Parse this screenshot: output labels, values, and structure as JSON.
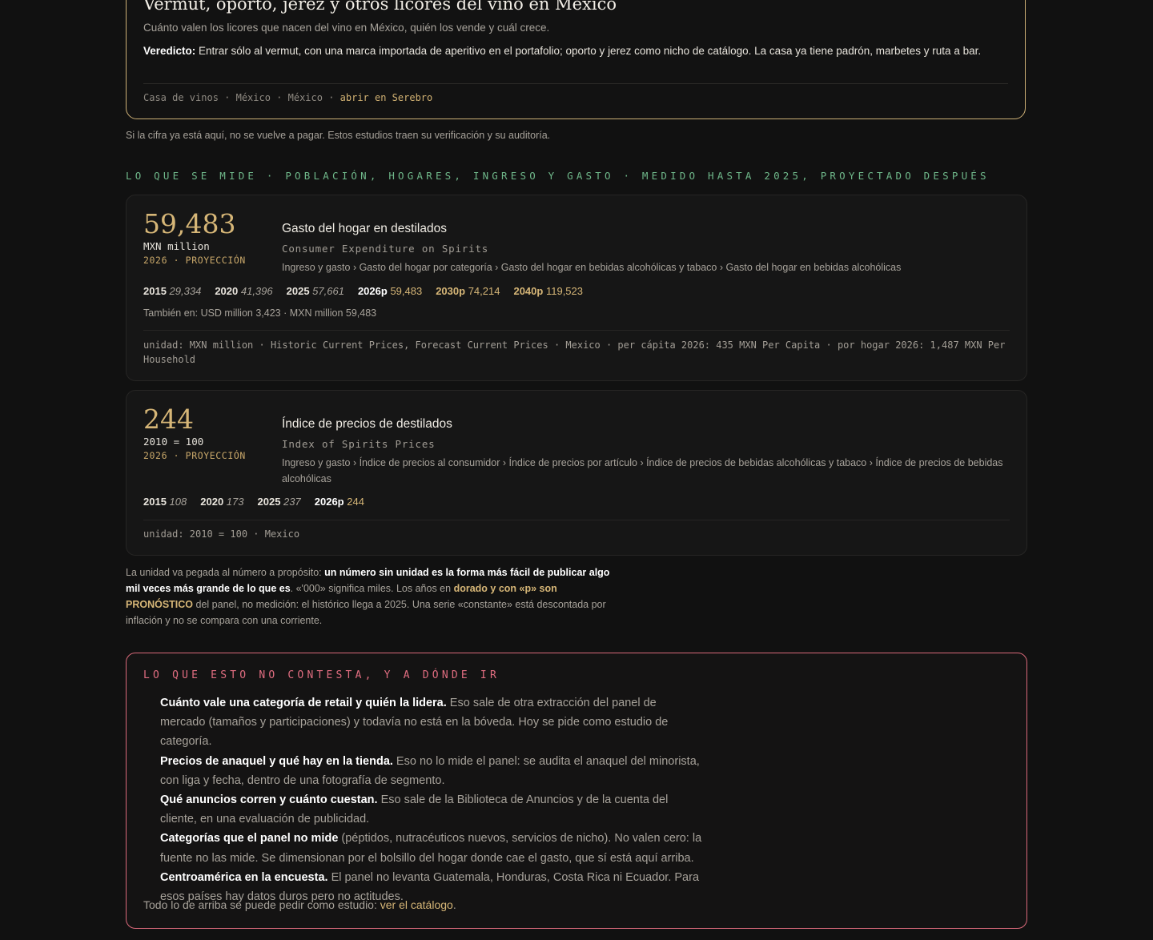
{
  "verdict": {
    "title": "Vermut, oporto, jerez y otros licores del vino en México",
    "subtitle": "Cuánto valen los licores que nacen del vino en México, quién los vende y cuál crece.",
    "label": "Veredicto:",
    "text": "Entrar sólo al vermut, con una marca importada de aperitivo en el portafolio; oporto y jerez como nicho de catálogo. La casa ya tiene padrón, marbetes y ruta a bar.",
    "meta": "Casa de vinos · México · México ·",
    "link": "abrir en Serebro"
  },
  "note": "Si la cifra ya está aquí, no se vuelve a pagar. Estos estudios traen su verificación y su auditoría.",
  "section_head": "LO QUE SE MIDE · POBLACIÓN, HOGARES, INGRESO Y GASTO · MEDIDO HASTA 2025, PROYECTADO DESPUÉS",
  "cards": [
    {
      "value": "59,483",
      "unit": "MXN million",
      "when": "2026 · PROYECCIÓN",
      "name": "Gasto del hogar en destilados",
      "name_en": "Consumer Expenditure on Spirits",
      "path": "Ingreso y gasto › Gasto del hogar por categoría › Gasto del hogar en bebidas alcohólicas y tabaco › Gasto del hogar en bebidas alcohólicas",
      "years": [
        {
          "y": "2015",
          "v": "29,334",
          "kind": "hist"
        },
        {
          "y": "2020",
          "v": "41,396",
          "kind": "hist"
        },
        {
          "y": "2025",
          "v": "57,661",
          "kind": "hist"
        },
        {
          "y": "2026p",
          "v": "59,483",
          "kind": "cur"
        },
        {
          "y": "2030p",
          "v": "74,214",
          "kind": "p"
        },
        {
          "y": "2040p",
          "v": "119,523",
          "kind": "p"
        }
      ],
      "also": "También en: USD million 3,423 · MXN million 59,483",
      "foot": "unidad: MXN million · Historic Current Prices, Forecast Current Prices · Mexico · per cápita 2026: 435 MXN Per Capita · por hogar 2026: 1,487 MXN Per Household"
    },
    {
      "value": "244",
      "unit": "2010 = 100",
      "when": "2026 · PROYECCIÓN",
      "name": "Índice de precios de destilados",
      "name_en": "Index of Spirits Prices",
      "path": "Ingreso y gasto › Índice de precios al consumidor › Índice de precios por artículo › Índice de precios de bebidas alcohólicas y tabaco › Índice de precios de bebidas alcohólicas",
      "years": [
        {
          "y": "2015",
          "v": "108",
          "kind": "hist"
        },
        {
          "y": "2020",
          "v": "173",
          "kind": "hist"
        },
        {
          "y": "2025",
          "v": "237",
          "kind": "hist"
        },
        {
          "y": "2026p",
          "v": "244",
          "kind": "cur"
        }
      ],
      "foot": "unidad: 2010 = 100 · Mexico"
    }
  ],
  "explain": {
    "a": "La unidad va pegada al número a propósito: ",
    "b": "un número sin unidad es la forma más fácil de publicar algo mil veces más grande de lo que es",
    "c": ". «'000» significa miles. Los años en ",
    "d": "dorado y con «p» son PRONÓSTICO",
    "e": " del panel, no medición: el histórico llega a 2025. Una serie «constante» está descontada por inflación y no se compara con una corriente."
  },
  "redbox": {
    "head": "LO QUE ESTO NO CONTESTA, Y A DÓNDE IR",
    "items": [
      {
        "b": "Cuánto vale una categoría de retail y quién la lidera.",
        "t": " Eso sale de otra extracción del panel de mercado (tamaños y participaciones) y todavía no está en la bóveda. Hoy se pide como estudio de categoría."
      },
      {
        "b": "Precios de anaquel y qué hay en la tienda.",
        "t": " Eso no lo mide el panel: se audita el anaquel del minorista, con liga y fecha, dentro de una fotografía de segmento."
      },
      {
        "b": "Qué anuncios corren y cuánto cuestan.",
        "t": " Eso sale de la Biblioteca de Anuncios y de la cuenta del cliente, en una evaluación de publicidad."
      },
      {
        "b": "Categorías que el panel no mide",
        "t": " (péptidos, nutracéuticos nuevos, servicios de nicho). No valen cero: la fuente no las mide. Se dimensionan por el bolsillo del hogar donde cae el gasto, que sí está aquí arriba."
      },
      {
        "b": "Centroamérica en la encuesta.",
        "t": " El panel no levanta Guatemala, Honduras, Costa Rica ni Ecuador. Para esos países hay datos duros pero no actitudes."
      }
    ],
    "end_text": "Todo lo de arriba se puede pedir como estudio: ",
    "end_link": "ver el catálogo",
    "end_dot": "."
  },
  "colors": {
    "gold": "#d6b677",
    "green": "#6fb88a",
    "red": "#e06d80",
    "bg": "#111111"
  }
}
